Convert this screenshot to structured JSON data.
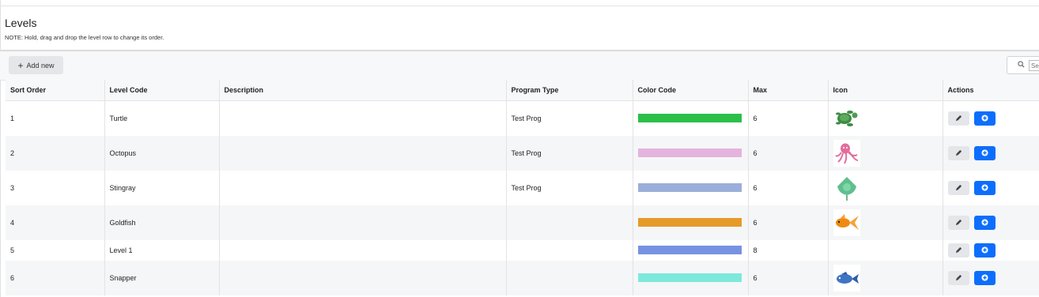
{
  "page": {
    "title": "Levels",
    "note": "NOTE: Hold, drag and drop the level row to change its order."
  },
  "toolbar": {
    "add_label": "Add new",
    "search_placeholder": "Search"
  },
  "table": {
    "columns": [
      "Sort Order",
      "Level Code",
      "Description",
      "Program Type",
      "Color Code",
      "Max",
      "Icon",
      "Actions"
    ],
    "rows": [
      {
        "sort_order": "1",
        "level_code": "Turtle",
        "description": "",
        "program_type": "Test Prog",
        "color": "#2bbf4a",
        "max": "6",
        "icon": "turtle-icon"
      },
      {
        "sort_order": "2",
        "level_code": "Octopus",
        "description": "",
        "program_type": "Test Prog",
        "color": "#e5b3de",
        "max": "6",
        "icon": "octopus-icon"
      },
      {
        "sort_order": "3",
        "level_code": "Stingray",
        "description": "",
        "program_type": "Test Prog",
        "color": "#9aafd9",
        "max": "6",
        "icon": "stingray-icon"
      },
      {
        "sort_order": "4",
        "level_code": "Goldfish",
        "description": "",
        "program_type": "",
        "color": "#e59a2a",
        "max": "6",
        "icon": "goldfish-icon"
      },
      {
        "sort_order": "5",
        "level_code": "Level 1",
        "description": "",
        "program_type": "",
        "color": "#7792e0",
        "max": "8",
        "icon": ""
      },
      {
        "sort_order": "6",
        "level_code": "Snapper",
        "description": "",
        "program_type": "",
        "color": "#7fe8dc",
        "max": "6",
        "icon": "snapper-fish-icon"
      }
    ]
  },
  "colors": {
    "primary": "#0d6efd",
    "header_bg": "#f7f8f9",
    "stripe_bg": "#f5f6f7"
  }
}
